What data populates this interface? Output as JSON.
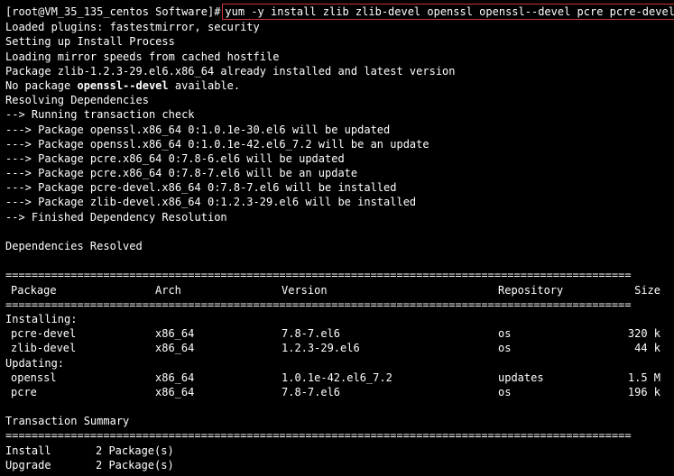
{
  "prompt": "[root@VM_35_135_centos Software]#",
  "command": "yum  -y install zlib zlib-devel openssl openssl--devel pcre pcre-devel",
  "lines": {
    "l1": "Loaded plugins: fastestmirror, security",
    "l2": "Setting up Install Process",
    "l3": "Loading mirror speeds from cached hostfile",
    "l4": "Package zlib-1.2.3-29.el6.x86_64 already installed and latest version",
    "l5a": "No package ",
    "l5b": "openssl--devel",
    "l5c": " available.",
    "l6": "Resolving Dependencies",
    "l7": "--> Running transaction check",
    "l8": "---> Package openssl.x86_64 0:1.0.1e-30.el6 will be updated",
    "l9": "---> Package openssl.x86_64 0:1.0.1e-42.el6_7.2 will be an update",
    "l10": "---> Package pcre.x86_64 0:7.8-6.el6 will be updated",
    "l11": "---> Package pcre.x86_64 0:7.8-7.el6 will be an update",
    "l12": "---> Package pcre-devel.x86_64 0:7.8-7.el6 will be installed",
    "l13": "---> Package zlib-devel.x86_64 0:1.2.3-29.el6 will be installed",
    "l14": "--> Finished Dependency Resolution",
    "l15": "Dependencies Resolved"
  },
  "dividers": {
    "dbl": "================================================================================================",
    "sgl": "------------------------------------------------------------------------------------------------"
  },
  "headers": {
    "package": "Package",
    "arch": "Arch",
    "version": "Version",
    "repository": "Repository",
    "size": "Size"
  },
  "sections": {
    "installing": "Installing:",
    "updating": "Updating:"
  },
  "packages": {
    "installing": [
      {
        "name": "pcre-devel",
        "arch": "x86_64",
        "version": "7.8-7.el6",
        "repo": "os",
        "size": "320 k"
      },
      {
        "name": "zlib-devel",
        "arch": "x86_64",
        "version": "1.2.3-29.el6",
        "repo": "os",
        "size": "44 k"
      }
    ],
    "updating": [
      {
        "name": "openssl",
        "arch": "x86_64",
        "version": "1.0.1e-42.el6_7.2",
        "repo": "updates",
        "size": "1.5 M"
      },
      {
        "name": "pcre",
        "arch": "x86_64",
        "version": "7.8-7.el6",
        "repo": "os",
        "size": "196 k"
      }
    ]
  },
  "transaction": {
    "title": "Transaction Summary",
    "install_label": "Install",
    "install_count": "2 Package(s)",
    "upgrade_label": "Upgrade",
    "upgrade_count": "2 Package(s)"
  }
}
